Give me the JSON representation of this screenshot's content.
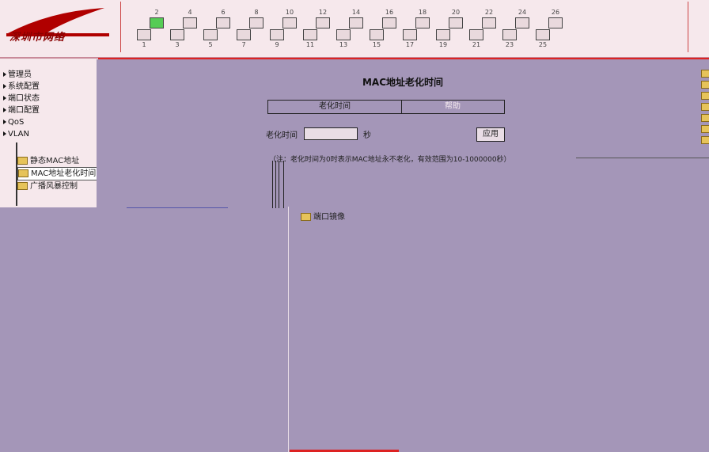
{
  "header": {
    "logo_text": "深圳市网络",
    "ports_top": [
      "2",
      "4",
      "6",
      "8",
      "10",
      "12",
      "14",
      "16",
      "18",
      "20",
      "22",
      "24",
      "26"
    ],
    "ports_bottom": [
      "1",
      "3",
      "5",
      "7",
      "9",
      "11",
      "13",
      "15",
      "17",
      "19",
      "21",
      "23",
      "25"
    ],
    "active_port": "2"
  },
  "sidebar": {
    "items": [
      {
        "label": "管理员"
      },
      {
        "label": "系统配置"
      },
      {
        "label": "端口状态"
      },
      {
        "label": "端口配置"
      },
      {
        "label": "QoS"
      },
      {
        "label": "VLAN"
      }
    ],
    "subitems": [
      {
        "label": "静态MAC地址"
      },
      {
        "label": "MAC地址老化时间"
      },
      {
        "label": "广播风暴控制"
      }
    ]
  },
  "main": {
    "title": "MAC地址老化时间",
    "tabs": [
      {
        "label": "老化时间"
      },
      {
        "label": "帮助"
      }
    ],
    "form_label": "老化时间",
    "form_value": "",
    "unit": "秒",
    "apply_label": "应用",
    "note": "（注：老化时间为0时表示MAC地址永不老化，有效范围为10-1000000秒）",
    "mirror_label": "端口镜像"
  },
  "colors": {
    "accent_red": "#d22222",
    "main_bg": "#a496b8",
    "frame_bg": "#f6e8ec",
    "port_active": "#55cc55"
  }
}
